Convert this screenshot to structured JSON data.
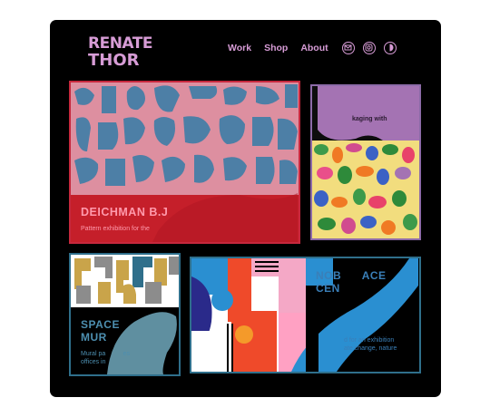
{
  "brand": {
    "logo_text": "RENATE THOR",
    "line1": "RENATE",
    "line2": "THOR",
    "color": "#d79cd6"
  },
  "nav": {
    "work": "Work",
    "shop": "Shop",
    "about": "About"
  },
  "social_icons": [
    "mail-icon",
    "instagram-icon",
    "dribbble-icon"
  ],
  "cards": [
    {
      "title": "DEICHMAN B.J",
      "desc": "Pattern exhibition for the",
      "accent": "#c6283d"
    },
    {
      "title": "",
      "desc": "kaging with",
      "accent": "#8d6ba8"
    },
    {
      "title_line1": "SPACE",
      "title_line2": "MUR",
      "desc_line1": "Mural pa          es",
      "desc_line2": "offices in",
      "accent": "#2f6f8b"
    },
    {
      "title_line1": "NOB      ACE",
      "title_line2": "CEN",
      "desc_line1": "d for an exhibition",
      "desc_line2": "ate change, nature",
      "accent": "#2f6f8b"
    }
  ]
}
